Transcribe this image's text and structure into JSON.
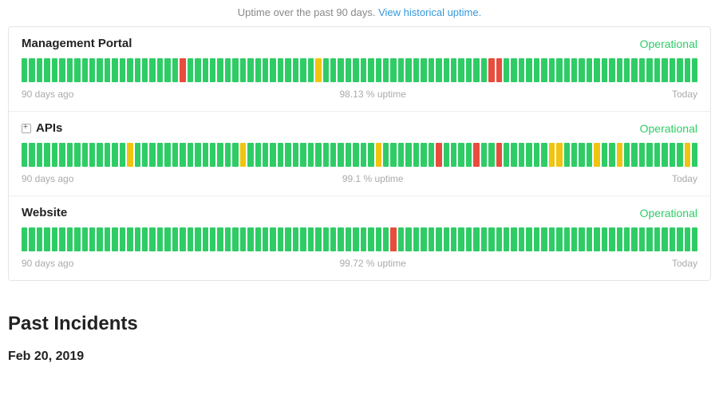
{
  "header": {
    "note": "Uptime over the past 90 days.",
    "link": "View historical uptime."
  },
  "labels": {
    "left": "90 days ago",
    "right": "Today"
  },
  "components": [
    {
      "name": "Management Portal",
      "status": "Operational",
      "uptime": "98.13 % uptime",
      "expandable": false,
      "bars": [
        "g",
        "g",
        "g",
        "g",
        "g",
        "g",
        "g",
        "g",
        "g",
        "g",
        "g",
        "g",
        "g",
        "g",
        "g",
        "g",
        "g",
        "g",
        "g",
        "g",
        "g",
        "r",
        "g",
        "g",
        "g",
        "g",
        "g",
        "g",
        "g",
        "g",
        "g",
        "g",
        "g",
        "g",
        "g",
        "g",
        "g",
        "g",
        "g",
        "y",
        "g",
        "g",
        "g",
        "g",
        "g",
        "g",
        "g",
        "g",
        "g",
        "g",
        "g",
        "g",
        "g",
        "g",
        "g",
        "g",
        "g",
        "g",
        "g",
        "g",
        "g",
        "g",
        "r",
        "r",
        "g",
        "g",
        "g",
        "g",
        "g",
        "g",
        "g",
        "g",
        "g",
        "g",
        "g",
        "g",
        "g",
        "g",
        "g",
        "g",
        "g",
        "g",
        "g",
        "g",
        "g",
        "g",
        "g",
        "g",
        "g",
        "g"
      ]
    },
    {
      "name": "APIs",
      "status": "Operational",
      "uptime": "99.1 % uptime",
      "expandable": true,
      "bars": [
        "g",
        "g",
        "g",
        "g",
        "g",
        "g",
        "g",
        "g",
        "g",
        "g",
        "g",
        "g",
        "g",
        "g",
        "y",
        "g",
        "g",
        "g",
        "g",
        "g",
        "g",
        "g",
        "g",
        "g",
        "g",
        "g",
        "g",
        "g",
        "g",
        "y",
        "g",
        "g",
        "g",
        "g",
        "g",
        "g",
        "g",
        "g",
        "g",
        "g",
        "g",
        "g",
        "g",
        "g",
        "g",
        "g",
        "g",
        "y",
        "g",
        "g",
        "g",
        "g",
        "g",
        "g",
        "g",
        "r",
        "g",
        "g",
        "g",
        "g",
        "r",
        "g",
        "g",
        "r",
        "g",
        "g",
        "g",
        "g",
        "g",
        "g",
        "y",
        "y",
        "g",
        "g",
        "g",
        "g",
        "y",
        "g",
        "g",
        "y",
        "g",
        "g",
        "g",
        "g",
        "g",
        "g",
        "g",
        "g",
        "y",
        "g"
      ]
    },
    {
      "name": "Website",
      "status": "Operational",
      "uptime": "99.72 % uptime",
      "expandable": false,
      "bars": [
        "g",
        "g",
        "g",
        "g",
        "g",
        "g",
        "g",
        "g",
        "g",
        "g",
        "g",
        "g",
        "g",
        "g",
        "g",
        "g",
        "g",
        "g",
        "g",
        "g",
        "g",
        "g",
        "g",
        "g",
        "g",
        "g",
        "g",
        "g",
        "g",
        "g",
        "g",
        "g",
        "g",
        "g",
        "g",
        "g",
        "g",
        "g",
        "g",
        "g",
        "g",
        "g",
        "g",
        "g",
        "g",
        "g",
        "g",
        "g",
        "g",
        "r",
        "g",
        "g",
        "g",
        "g",
        "g",
        "g",
        "g",
        "g",
        "g",
        "g",
        "g",
        "g",
        "g",
        "g",
        "g",
        "g",
        "g",
        "g",
        "g",
        "g",
        "g",
        "g",
        "g",
        "g",
        "g",
        "g",
        "g",
        "g",
        "g",
        "g",
        "g",
        "g",
        "g",
        "g",
        "g",
        "g",
        "g",
        "g",
        "g",
        "g"
      ]
    }
  ],
  "pastIncidents": {
    "heading": "Past Incidents",
    "date": "Feb 20, 2019"
  },
  "colorMap": {
    "g": "green",
    "y": "yellow",
    "r": "red",
    "o": "orange"
  }
}
